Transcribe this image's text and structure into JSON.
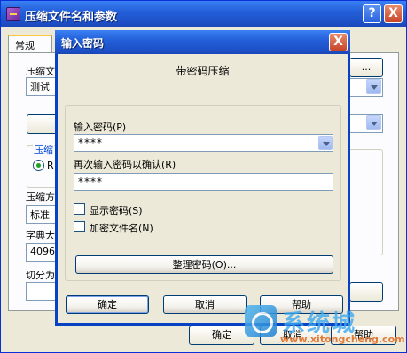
{
  "back_window": {
    "title": "压缩文件名和参数",
    "help_glyph": "?",
    "close_glyph": "X",
    "tab_general": "常规",
    "archive_label": "压缩文",
    "archive_value": "测试.",
    "browse_label": "...",
    "format_label": "压缩",
    "format_option": "R",
    "method_label": "压缩方",
    "method_value": "标准",
    "dict_label": "字典大",
    "dict_value": "4096",
    "split_label": "切分为",
    "ok_label": "确定",
    "cancel_label": "取消",
    "help_label": "帮助"
  },
  "dialog": {
    "title": "输入密码",
    "close_glyph": "X",
    "heading": "带密码压缩",
    "password_label": "输入密码(P)",
    "password_value": "****",
    "confirm_label": "再次输入密码以确认(R)",
    "confirm_value": "****",
    "show_password_label": "显示密码(S)",
    "encrypt_names_label": "加密文件名(N)",
    "organize_label": "整理密码(O)...",
    "ok_label": "确定",
    "cancel_label": "取消",
    "help_label": "帮助"
  },
  "watermark": {
    "brand": "系统城",
    "url": "www.xitongcheng.com"
  },
  "colors": {
    "title_bar": "#2460d9",
    "window_bg": "#ece9d8",
    "close_button": "#c6452a",
    "watermark_brand": "#3ca7ef",
    "watermark_url": "#e07a39"
  }
}
